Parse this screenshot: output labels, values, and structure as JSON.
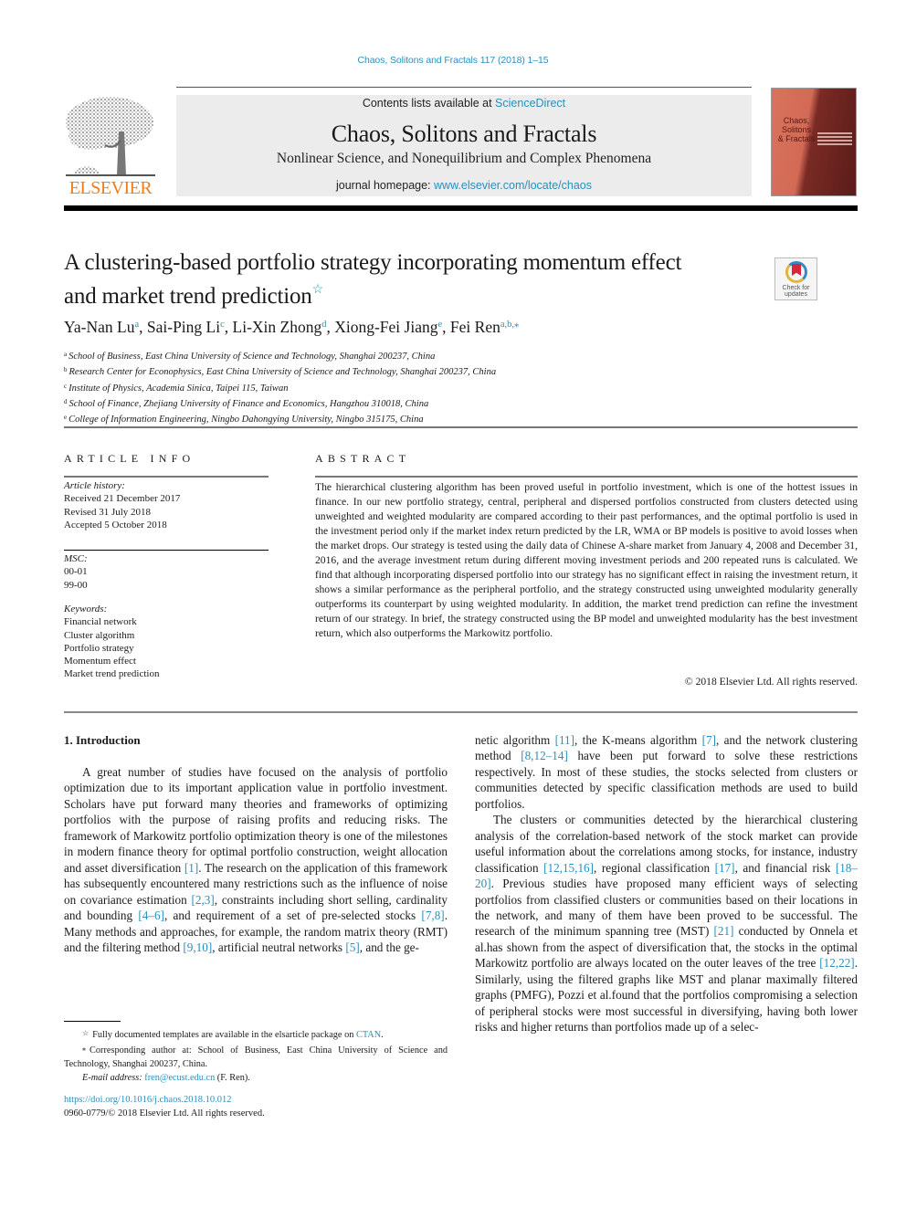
{
  "running_head": "Chaos, Solitons and Fractals 117 (2018) 1–15",
  "masthead": {
    "publisher_logo_label": "ELSEVIER",
    "contents_prefix": "Contents lists available at ",
    "contents_link": "ScienceDirect",
    "journal_title": "Chaos, Solitons and Fractals",
    "journal_subtitle": "Nonlinear Science, and Nonequilibrium and Complex Phenomena",
    "homepage_prefix": "journal homepage: ",
    "homepage_link": "www.elsevier.com/locate/chaos",
    "cover_title_lines": [
      "Chaos,",
      "Solitons",
      "& Fractals"
    ]
  },
  "article": {
    "title_line1": "A clustering-based portfolio strategy incorporating momentum effect",
    "title_line2": "and market trend prediction",
    "title_footnote_mark": "☆",
    "check_updates_label_1": "Check for",
    "check_updates_label_2": "updates",
    "authors": [
      {
        "name": "Ya-Nan Lu",
        "aff": "a",
        "sep": ", "
      },
      {
        "name": "Sai-Ping Li",
        "aff": "c",
        "sep": ", "
      },
      {
        "name": "Li-Xin Zhong",
        "aff": "d",
        "sep": ", "
      },
      {
        "name": "Xiong-Fei Jiang",
        "aff": "e",
        "sep": ", "
      },
      {
        "name": "Fei Ren",
        "aff": "a,b,⁎",
        "sep": ""
      }
    ],
    "affiliations": [
      {
        "key": "a",
        "text": "School of Business, East China University of Science and Technology, Shanghai 200237, China"
      },
      {
        "key": "b",
        "text": "Research Center for Econophysics, East China University of Science and Technology, Shanghai 200237, China"
      },
      {
        "key": "c",
        "text": "Institute of Physics, Academia Sinica, Taipei 115, Taiwan"
      },
      {
        "key": "d",
        "text": "School of Finance, Zhejiang University of Finance and Economics, Hangzhou 310018, China"
      },
      {
        "key": "e",
        "text": "College of Information Engineering, Ningbo Dahongying University, Ningbo 315175, China"
      }
    ]
  },
  "article_info": {
    "heading": "ARTICLE INFO",
    "history_label": "Article history:",
    "history": [
      "Received 21 December 2017",
      "Revised 31 July 2018",
      "Accepted 5 October 2018"
    ],
    "msc_label": "MSC:",
    "msc": [
      "00-01",
      "99-00"
    ],
    "keywords_label": "Keywords:",
    "keywords": [
      "Financial network",
      "Cluster algorithm",
      "Portfolio strategy",
      "Momentum effect",
      "Market trend prediction"
    ]
  },
  "abstract": {
    "heading": "ABSTRACT",
    "text": "The hierarchical clustering algorithm has been proved useful in portfolio investment, which is one of the hottest issues in finance. In our new portfolio strategy, central, peripheral and dispersed portfolios constructed from clusters detected using unweighted and weighted modularity are compared according to their past performances, and the optimal portfolio is used in the investment period only if the market index return predicted by the LR, WMA or BP models is positive to avoid losses when the market drops. Our strategy is tested using the daily data of Chinese A-share market from January 4, 2008 and December 31, 2016, and the average investment retum during different moving investment periods and 200 repeated runs is calculated. We find that although incorporating dispersed portfolio into our strategy has no significant effect in raising the investment return, it shows a similar performance as the peripheral portfolio, and the strategy constructed using unweighted modularity generally outperforms its counterpart by using weighted modularity. In addition, the market trend prediction can refine the investment return of our strategy. In brief, the strategy constructed using the BP model and unweighted modularity has the best investment return, which also outperforms the Markowitz portfolio.",
    "copyright": "© 2018 Elsevier Ltd. All rights reserved."
  },
  "body": {
    "section_heading": "1. Introduction",
    "left_paragraph": [
      {
        "t": "A great number of studies have focused on the analysis of portfolio optimization due to its important application value in portfolio investment. Scholars have put forward many theories and frameworks of optimizing portfolios with the purpose of raising profits and reducing risks. The framework of Markowitz portfolio optimization theory is one of the milestones in modern finance theory for optimal portfolio construction, weight allocation and asset diversification "
      },
      {
        "ref": "[1]"
      },
      {
        "t": ". The research on the application of this framework has subsequently encountered many restrictions such as the influence of noise on covariance estimation "
      },
      {
        "ref": "[2,3]"
      },
      {
        "t": ", constraints including short selling, cardinality and bounding "
      },
      {
        "ref": "[4–6]"
      },
      {
        "t": ", and requirement of a set of pre-selected stocks "
      },
      {
        "ref": "[7,8]"
      },
      {
        "t": ". Many methods and approaches, for example, the random matrix theory (RMT) and the filtering method "
      },
      {
        "ref": "[9,10]"
      },
      {
        "t": ", artificial neutral networks "
      },
      {
        "ref": "[5]"
      },
      {
        "t": ", and the ge-"
      }
    ],
    "right_paragraph_1": [
      {
        "t": "netic algorithm "
      },
      {
        "ref": "[11]"
      },
      {
        "t": ", the K-means algorithm "
      },
      {
        "ref": "[7]"
      },
      {
        "t": ", and the network clustering method "
      },
      {
        "ref": "[8,12–14]"
      },
      {
        "t": " have been put forward to solve these restrictions respectively. In most of these studies, the stocks selected from clusters or communities detected by specific classification methods are used to build portfolios."
      }
    ],
    "right_paragraph_2": [
      {
        "t": "The clusters or communities detected by the hierarchical clustering analysis of the correlation-based network of the stock market can provide useful information about the correlations among stocks, for instance, industry classification "
      },
      {
        "ref": "[12,15,16]"
      },
      {
        "t": ", regional classification "
      },
      {
        "ref": "[17]"
      },
      {
        "t": ", and financial risk "
      },
      {
        "ref": "[18–20]"
      },
      {
        "t": ". Previous studies have proposed many efficient ways of selecting portfolios from classified clusters or communities based on their locations in the network, and many of them have been proved to be successful. The research of the minimum spanning tree (MST) "
      },
      {
        "ref": "[21]"
      },
      {
        "t": " conducted by Onnela et al.has shown from the aspect of diversification that, the stocks in the optimal Markowitz portfolio are always located on the outer leaves of the tree "
      },
      {
        "ref": "[12,22]"
      },
      {
        "t": ". Similarly, using the filtered graphs like MST and planar maximally filtered graphs (PMFG), Pozzi et al.found that the portfolios compromising a selection of peripheral stocks were most successful in diversifying, having both lower risks and higher returns than portfolios made up of a selec-"
      }
    ]
  },
  "footnotes": {
    "star_mark": "☆",
    "star_text": "Fully documented templates are available in the elsarticle package on ",
    "star_link": "CTAN",
    "star_end": ".",
    "corr_mark": "⁎",
    "corr_text": "Corresponding author at: School of Business, East China University of Science and Technology, Shanghai 200237, China.",
    "email_label": "E-mail address: ",
    "email": "fren@ecust.edu.cn",
    "email_suffix": " (F. Ren).",
    "doi": "https://doi.org/10.1016/j.chaos.2018.10.012",
    "issn_line": "0960-0779/© 2018 Elsevier Ltd. All rights reserved."
  }
}
